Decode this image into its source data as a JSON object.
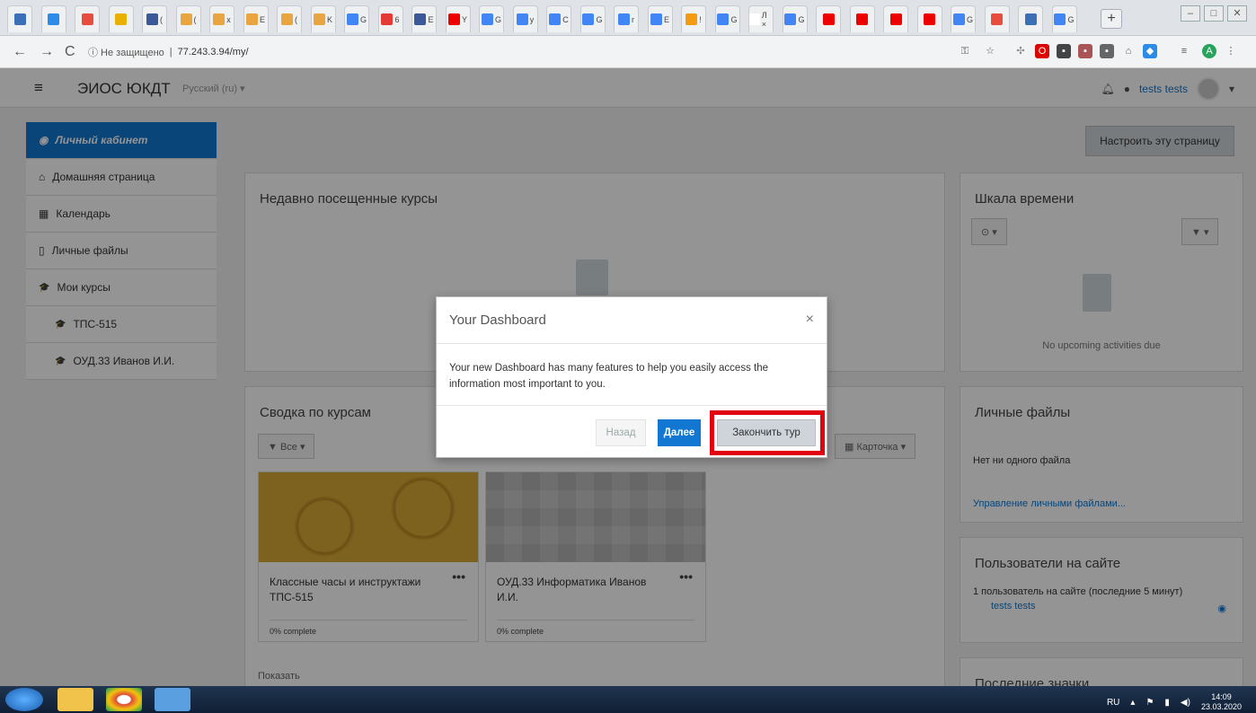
{
  "browser": {
    "tabs": [
      {
        "label": "",
        "color": "#3b6fb6"
      },
      {
        "label": "",
        "color": "#2a8be8"
      },
      {
        "label": "",
        "color": "#e84c3d"
      },
      {
        "label": "",
        "color": "#e9b000"
      },
      {
        "label": "(",
        "color": "#3b5998"
      },
      {
        "label": "(",
        "color": "#e9a640"
      },
      {
        "label": "x",
        "color": "#e9a640"
      },
      {
        "label": "E",
        "color": "#e9a640"
      },
      {
        "label": "(",
        "color": "#e9a640"
      },
      {
        "label": "K",
        "color": "#e9a640"
      },
      {
        "label": "G",
        "color": "#4285f4"
      },
      {
        "label": "6",
        "color": "#e53935"
      },
      {
        "label": "E",
        "color": "#3b5998"
      },
      {
        "label": "Y",
        "color": "#e00"
      },
      {
        "label": "G",
        "color": "#4285f4"
      },
      {
        "label": "y",
        "color": "#4285f4"
      },
      {
        "label": "C",
        "color": "#4285f4"
      },
      {
        "label": "G",
        "color": "#4285f4"
      },
      {
        "label": "r",
        "color": "#4285f4"
      },
      {
        "label": "E",
        "color": "#4285f4"
      },
      {
        "label": "!",
        "color": "#f39c12"
      },
      {
        "label": "G",
        "color": "#4285f4"
      },
      {
        "label": "Л ×",
        "color": "#ffffff"
      },
      {
        "label": "G",
        "color": "#4285f4"
      },
      {
        "label": "",
        "color": "#e00"
      },
      {
        "label": "",
        "color": "#e00"
      },
      {
        "label": "",
        "color": "#e00"
      },
      {
        "label": "",
        "color": "#e00"
      },
      {
        "label": "G",
        "color": "#4285f4"
      },
      {
        "label": "",
        "color": "#e84c3d"
      },
      {
        "label": "",
        "color": "#3b6fb6"
      },
      {
        "label": "G",
        "color": "#4285f4"
      }
    ],
    "new_tab": "+",
    "window_controls": [
      "–",
      "□",
      "✕"
    ],
    "nav": {
      "back": "←",
      "forward": "→",
      "reload": "C"
    },
    "security_label": "ⓘ Не защищено",
    "url_separator": "|",
    "url": "77.243.3.94/my/"
  },
  "site": {
    "menu_icon": "≡",
    "brand": "ЭИОС ЮКДТ",
    "language": "Русский (ru) ▾",
    "user_name": "tests tests",
    "user_caret": "▾"
  },
  "drawer": {
    "items": [
      {
        "label": "Личный кабинет",
        "icon": "dashboard-icon",
        "glyph": "◉"
      },
      {
        "label": "Домашняя страница",
        "icon": "home-icon",
        "glyph": "⌂"
      },
      {
        "label": "Календарь",
        "icon": "calendar-icon",
        "glyph": "▦"
      },
      {
        "label": "Личные файлы",
        "icon": "file-icon",
        "glyph": "▯"
      },
      {
        "label": "Мои курсы",
        "icon": "graduation-cap-icon",
        "glyph": "🎓"
      },
      {
        "label": "ТПС-515",
        "icon": "graduation-cap-icon",
        "glyph": "🎓"
      },
      {
        "label": "ОУД.33 Иванов И.И.",
        "icon": "graduation-cap-icon",
        "glyph": "🎓"
      }
    ]
  },
  "main": {
    "customize_button": "Настроить эту страницу",
    "recent_title": "Недавно посещенные курсы",
    "overview_title": "Сводка по курсам",
    "filter_all": "▼ Все ▾",
    "view_mode": "▦ Карточка ▾",
    "courses": [
      {
        "name": "Классные часы и инструктажи ТПС-515",
        "progress": "0% complete",
        "menu": "•••",
        "image_color": "#d8a835"
      },
      {
        "name": "ОУД.33 Информатика Иванов И.И.",
        "progress": "0% complete",
        "menu": "•••",
        "image_color": "#c9c9c9"
      }
    ],
    "per_page_label": "Показать"
  },
  "right": {
    "timeline_title": "Шкала времени",
    "timeline_sort": "⊙ ▾",
    "timeline_filter": "▼ ▾",
    "timeline_empty": "No upcoming activities due",
    "files_title": "Личные файлы",
    "files_empty": "Нет ни одного файла",
    "files_manage": "Управление личными файлами...",
    "online_title": "Пользователи на сайте",
    "online_count": "1 пользователь на сайте (последние 5 минут)",
    "online_user": "tests tests",
    "badges_title": "Последние значки"
  },
  "dialog": {
    "title": "Your Dashboard",
    "close": "×",
    "body": "Your new Dashboard has many features to help you easily access the information most important to you.",
    "back_button": "Назад",
    "next_button": "Далее",
    "end_button": "Закончить тур",
    "highlight_color": "#e00010"
  },
  "taskbar": {
    "apps": [
      {
        "name": "start",
        "color": "#2f7bd6"
      },
      {
        "name": "explorer",
        "color": "#f2c34a"
      },
      {
        "name": "chrome",
        "color": "#dd4b39"
      },
      {
        "name": "folder",
        "color": "#5aa0e0"
      }
    ],
    "lang": "RU",
    "time": "14:09",
    "date": "23.03.2020"
  }
}
